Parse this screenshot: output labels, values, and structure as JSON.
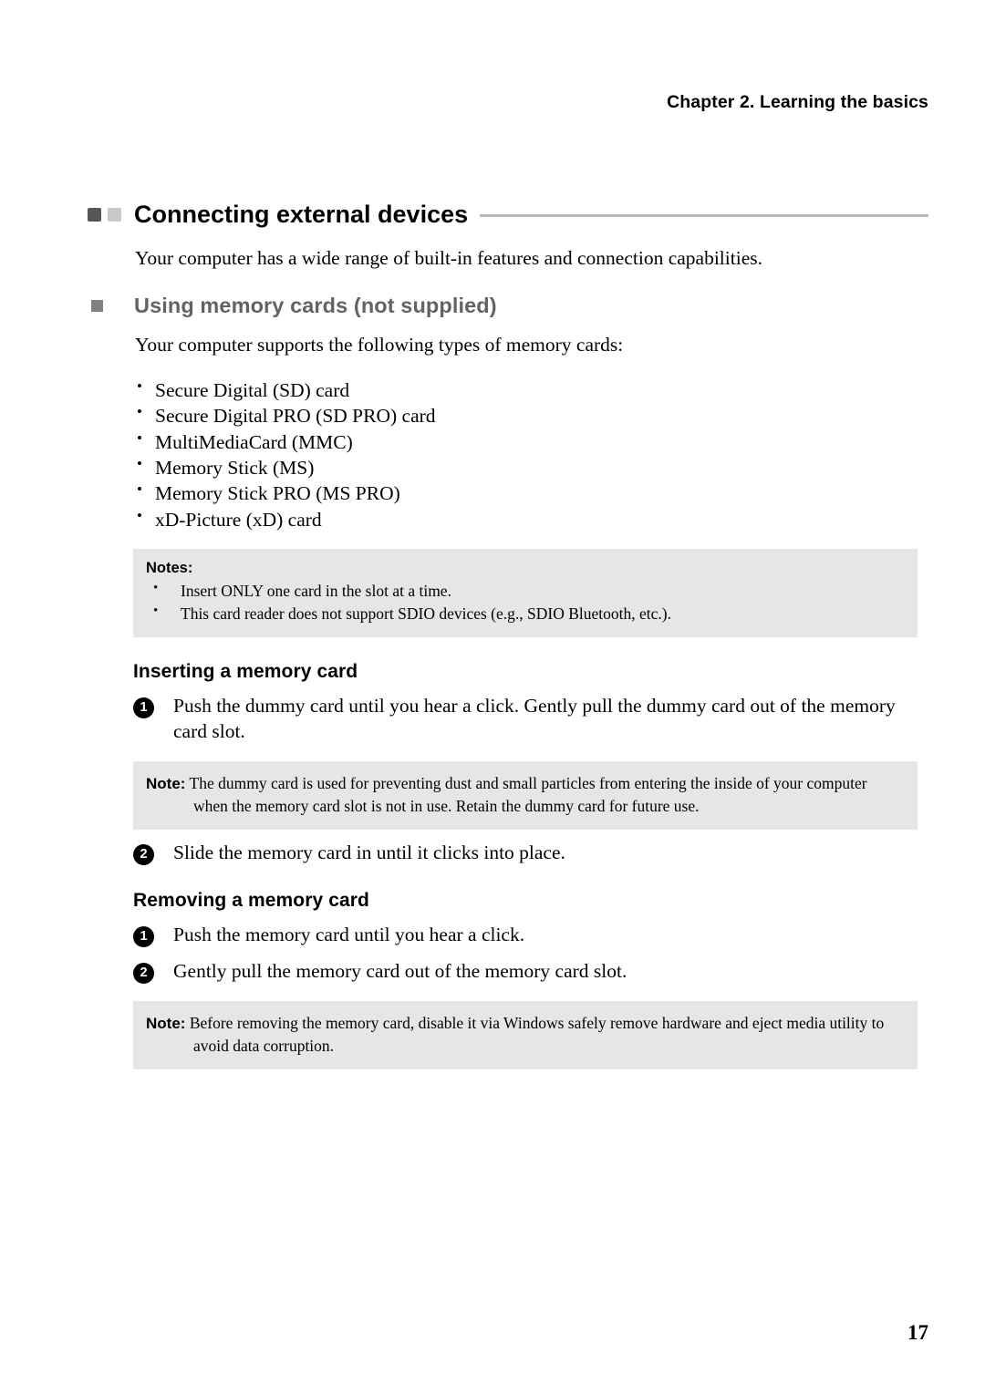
{
  "header": {
    "chapter_title": "Chapter 2. Learning the basics"
  },
  "heading": {
    "title": "Connecting external devices",
    "marker_dark_color": "#565656",
    "marker_light_color": "#c9c9c9",
    "rule_color": "#b9b9b9"
  },
  "intro_paragraph": "Your computer has a wide range of built-in features and connection capabilities.",
  "section": {
    "title": "Using memory cards (not supplied)",
    "bullet_color": "#818181",
    "title_color": "#636363",
    "lead": "Your computer supports the following types of memory cards:",
    "card_types": [
      "Secure Digital (SD) card",
      "Secure Digital PRO (SD PRO) card",
      "MultiMediaCard (MMC)",
      "Memory Stick (MS)",
      "Memory Stick PRO (MS PRO)",
      "xD-Picture (xD) card"
    ]
  },
  "notes_box": {
    "title": "Notes:",
    "background": "#e6e6e6",
    "items": [
      "Insert ONLY one card in the slot at a time.",
      "This card reader does not support SDIO devices (e.g., SDIO Bluetooth, etc.)."
    ]
  },
  "inserting": {
    "title": "Inserting a memory card",
    "steps": [
      {
        "number": "1",
        "text": "Push the dummy card until you hear a click. Gently pull the dummy card out of the memory card slot."
      },
      {
        "number": "2",
        "text": "Slide the memory card in until it clicks into place."
      }
    ]
  },
  "note_dummy_card": {
    "label": "Note:",
    "text": "The dummy card is used for preventing dust and small particles from entering the inside of your computer when the memory card slot is not in use. Retain the dummy card for future use."
  },
  "removing": {
    "title": "Removing a memory card",
    "steps": [
      {
        "number": "1",
        "text": "Push the memory card until you hear a click."
      },
      {
        "number": "2",
        "text": "Gently pull the memory card out of the memory card slot."
      }
    ]
  },
  "note_removing": {
    "label": "Note:",
    "text": "Before removing the memory card, disable it via Windows safely remove hardware and eject media utility to avoid data corruption."
  },
  "footer": {
    "page_number": "17"
  }
}
